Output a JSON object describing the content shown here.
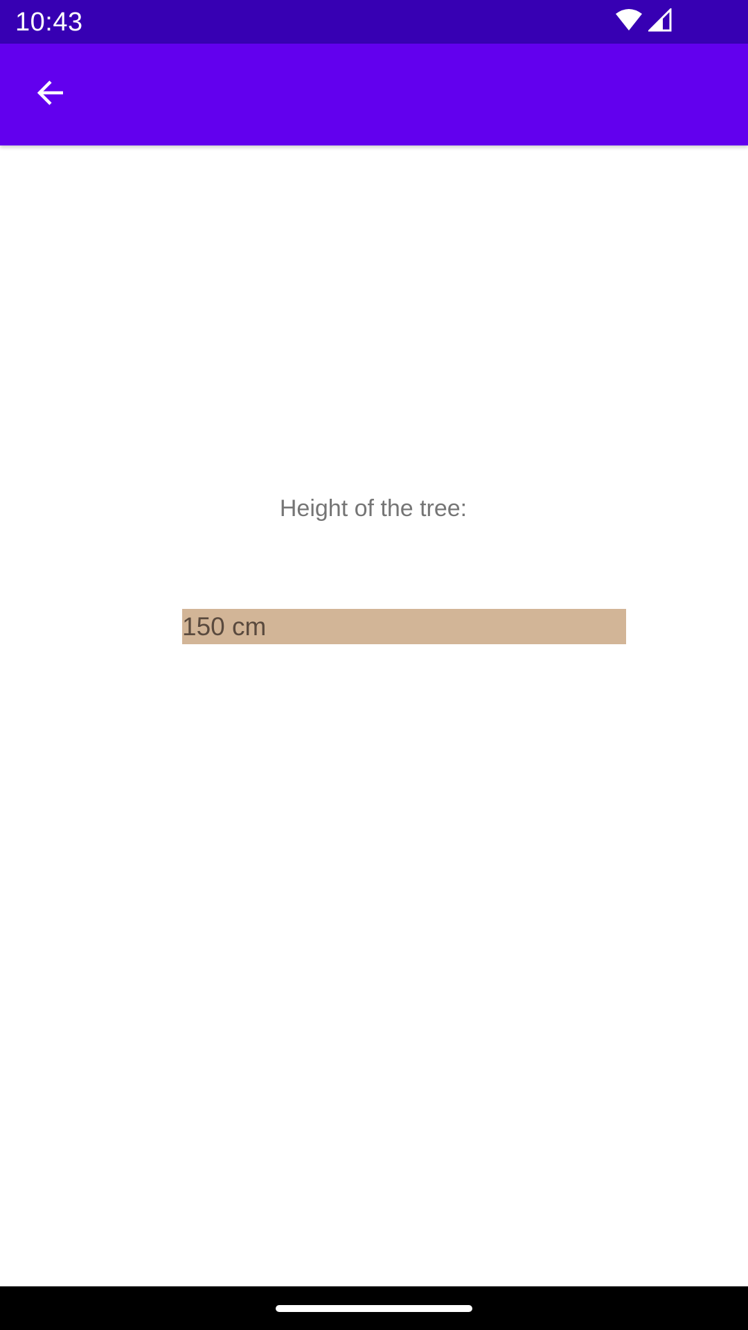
{
  "status_bar": {
    "time": "10:43",
    "icons": [
      "wifi-icon",
      "cellular-signal-icon"
    ],
    "background_color": "#3700b3"
  },
  "app_bar": {
    "back_icon": "arrow-back-icon",
    "background_color": "#6200ee"
  },
  "content": {
    "label": "Height of the tree:",
    "value": "150 cm",
    "value_background_color": "#d2b597"
  },
  "nav_bar": {
    "handle": "home-gesture-pill"
  }
}
